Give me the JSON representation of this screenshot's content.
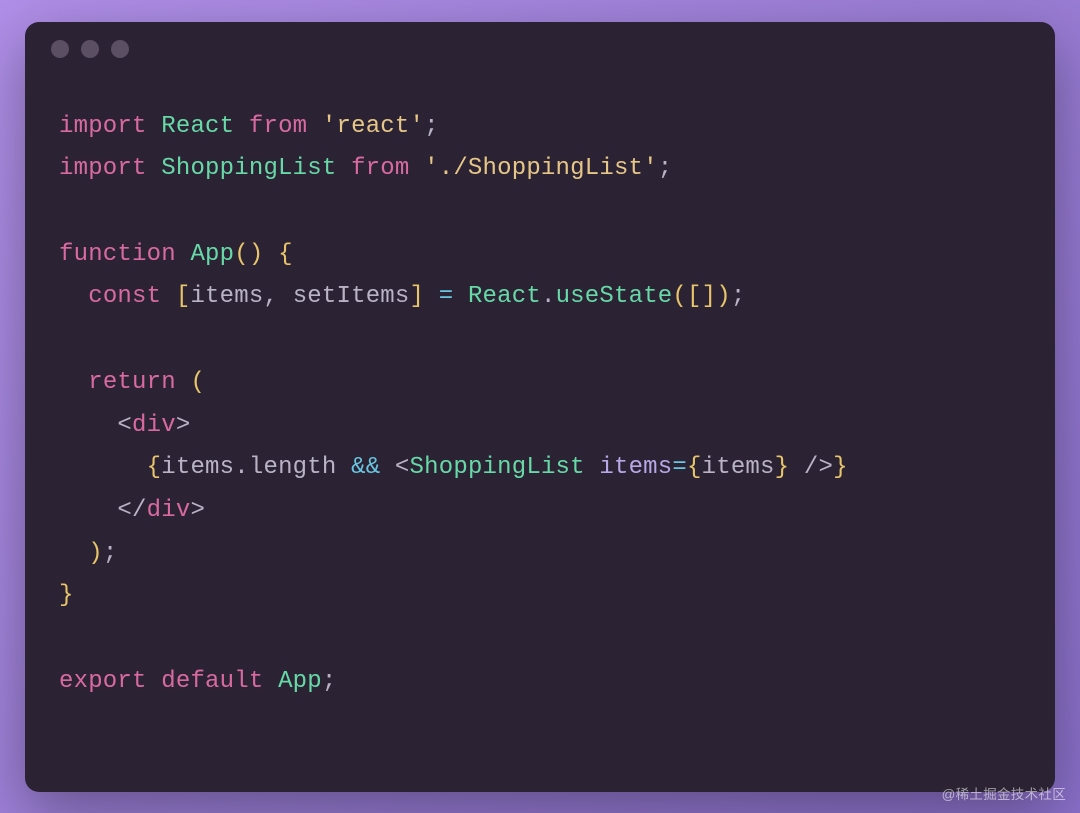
{
  "colors": {
    "bg_window": "#2b2334",
    "dot": "#5a4f63",
    "keyword": "#d86aa1",
    "identifier": "#66d9a7",
    "string": "#e7c787",
    "punctuation": "#b9b3c5",
    "operator": "#69c6e0",
    "attr": "#b7a7e6",
    "bracket": "#e8c56a"
  },
  "watermark": "@稀土掘金技术社区",
  "code": {
    "lines": [
      [
        {
          "t": "import",
          "c": "kw"
        },
        {
          "t": " ",
          "c": "punc"
        },
        {
          "t": "React",
          "c": "id"
        },
        {
          "t": " ",
          "c": "punc"
        },
        {
          "t": "from",
          "c": "kw"
        },
        {
          "t": " ",
          "c": "punc"
        },
        {
          "t": "'react'",
          "c": "str"
        },
        {
          "t": ";",
          "c": "punc"
        }
      ],
      [
        {
          "t": "import",
          "c": "kw"
        },
        {
          "t": " ",
          "c": "punc"
        },
        {
          "t": "ShoppingList",
          "c": "id"
        },
        {
          "t": " ",
          "c": "punc"
        },
        {
          "t": "from",
          "c": "kw"
        },
        {
          "t": " ",
          "c": "punc"
        },
        {
          "t": "'./ShoppingList'",
          "c": "str"
        },
        {
          "t": ";",
          "c": "punc"
        }
      ],
      [],
      [
        {
          "t": "function",
          "c": "kw"
        },
        {
          "t": " ",
          "c": "punc"
        },
        {
          "t": "App",
          "c": "id"
        },
        {
          "t": "()",
          "c": "brkt"
        },
        {
          "t": " ",
          "c": "punc"
        },
        {
          "t": "{",
          "c": "brkt"
        }
      ],
      [
        {
          "t": "  ",
          "c": "punc"
        },
        {
          "t": "const",
          "c": "kw"
        },
        {
          "t": " ",
          "c": "punc"
        },
        {
          "t": "[",
          "c": "brkt"
        },
        {
          "t": "items",
          "c": "punc"
        },
        {
          "t": ",",
          "c": "punc"
        },
        {
          "t": " ",
          "c": "punc"
        },
        {
          "t": "setItems",
          "c": "punc"
        },
        {
          "t": "]",
          "c": "brkt"
        },
        {
          "t": " ",
          "c": "punc"
        },
        {
          "t": "=",
          "c": "op"
        },
        {
          "t": " ",
          "c": "punc"
        },
        {
          "t": "React",
          "c": "id"
        },
        {
          "t": ".",
          "c": "punc"
        },
        {
          "t": "useState",
          "c": "id"
        },
        {
          "t": "([])",
          "c": "brkt"
        },
        {
          "t": ";",
          "c": "punc"
        }
      ],
      [],
      [
        {
          "t": "  ",
          "c": "punc"
        },
        {
          "t": "return",
          "c": "kw"
        },
        {
          "t": " ",
          "c": "punc"
        },
        {
          "t": "(",
          "c": "brkt"
        }
      ],
      [
        {
          "t": "    ",
          "c": "punc"
        },
        {
          "t": "<",
          "c": "punc"
        },
        {
          "t": "div",
          "c": "tag"
        },
        {
          "t": ">",
          "c": "punc"
        }
      ],
      [
        {
          "t": "      ",
          "c": "punc"
        },
        {
          "t": "{",
          "c": "brkt"
        },
        {
          "t": "items",
          "c": "punc"
        },
        {
          "t": ".",
          "c": "punc"
        },
        {
          "t": "length",
          "c": "punc"
        },
        {
          "t": " ",
          "c": "punc"
        },
        {
          "t": "&&",
          "c": "op"
        },
        {
          "t": " ",
          "c": "punc"
        },
        {
          "t": "<",
          "c": "punc"
        },
        {
          "t": "ShoppingList",
          "c": "id"
        },
        {
          "t": " ",
          "c": "punc"
        },
        {
          "t": "items",
          "c": "attr"
        },
        {
          "t": "=",
          "c": "op"
        },
        {
          "t": "{",
          "c": "brkt"
        },
        {
          "t": "items",
          "c": "punc"
        },
        {
          "t": "}",
          "c": "brkt"
        },
        {
          "t": " ",
          "c": "punc"
        },
        {
          "t": "/>",
          "c": "punc"
        },
        {
          "t": "}",
          "c": "brkt"
        }
      ],
      [
        {
          "t": "    ",
          "c": "punc"
        },
        {
          "t": "</",
          "c": "punc"
        },
        {
          "t": "div",
          "c": "tag"
        },
        {
          "t": ">",
          "c": "punc"
        }
      ],
      [
        {
          "t": "  ",
          "c": "punc"
        },
        {
          "t": ")",
          "c": "brkt"
        },
        {
          "t": ";",
          "c": "punc"
        }
      ],
      [
        {
          "t": "}",
          "c": "brkt"
        }
      ],
      [],
      [
        {
          "t": "export",
          "c": "kw"
        },
        {
          "t": " ",
          "c": "punc"
        },
        {
          "t": "default",
          "c": "kw"
        },
        {
          "t": " ",
          "c": "punc"
        },
        {
          "t": "App",
          "c": "id"
        },
        {
          "t": ";",
          "c": "punc"
        }
      ]
    ]
  }
}
